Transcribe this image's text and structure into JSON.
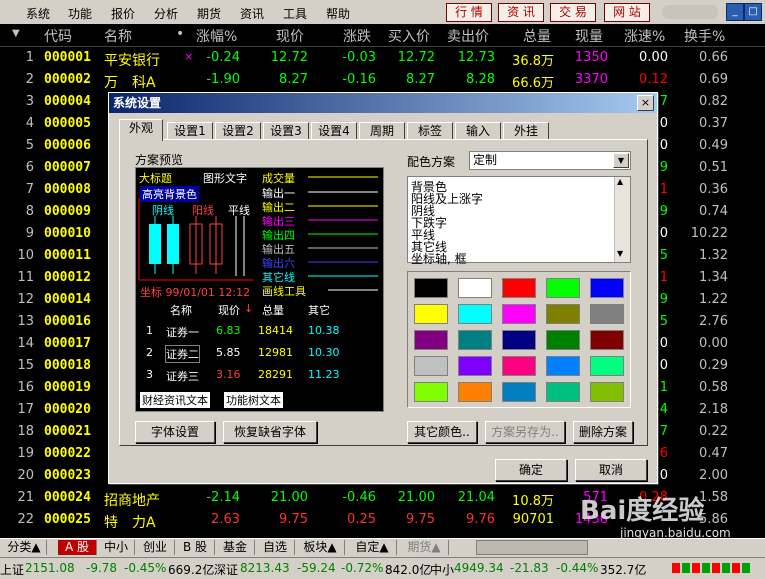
{
  "menu": [
    "系统",
    "功能",
    "报价",
    "分析",
    "期货",
    "资讯",
    "工具",
    "帮助"
  ],
  "toolbar_buttons": [
    "行 情",
    "资 讯",
    "交 易",
    "网 站"
  ],
  "window_controls": [
    "_",
    "□",
    "×"
  ],
  "columns": [
    "代码",
    "名称",
    "•",
    "涨幅%",
    "现价",
    "涨跌",
    "买入价",
    "卖出价",
    "总量",
    "现量",
    "涨速%",
    "换手%"
  ],
  "rows": [
    {
      "n": "1",
      "code": "000001",
      "name": "平安银行",
      "mark": "×",
      "chg_pct": "-0.24",
      "price": "12.72",
      "chg": "-0.03",
      "bid": "12.72",
      "ask": "12.73",
      "vol": "36.8万",
      "cur": "1350",
      "speed": "0.00",
      "turn": "0.66"
    },
    {
      "n": "2",
      "code": "000002",
      "name": "万　科A",
      "mark": "",
      "chg_pct": "-1.90",
      "price": "8.27",
      "chg": "-0.16",
      "bid": "8.27",
      "ask": "8.28",
      "vol": "66.6万",
      "cur": "3370",
      "speed": "0.12",
      "turn": "0.69"
    },
    {
      "n": "3",
      "code": "000004",
      "name": "",
      "speed": "7",
      "turn": "0.82"
    },
    {
      "n": "4",
      "code": "000005",
      "name": "",
      "speed": "0",
      "turn": "0.37"
    },
    {
      "n": "5",
      "code": "000006",
      "name": "",
      "speed": "0",
      "turn": "0.49"
    },
    {
      "n": "6",
      "code": "000007",
      "name": "",
      "speed": "9",
      "turn": "0.51"
    },
    {
      "n": "7",
      "code": "000008",
      "name": "",
      "speed": "1",
      "turn": "0.36"
    },
    {
      "n": "8",
      "code": "000009",
      "name": "",
      "speed": "9",
      "turn": "0.74"
    },
    {
      "n": "9",
      "code": "000010",
      "name": "",
      "speed": "0",
      "turn": "10.22"
    },
    {
      "n": "10",
      "code": "000011",
      "name": "",
      "speed": "5",
      "turn": "1.32"
    },
    {
      "n": "11",
      "code": "000012",
      "name": "",
      "speed": "1",
      "turn": "1.34"
    },
    {
      "n": "12",
      "code": "000014",
      "name": "",
      "speed": "9",
      "turn": "1.22"
    },
    {
      "n": "13",
      "code": "000016",
      "name": "",
      "speed": "5",
      "turn": "2.76"
    },
    {
      "n": "14",
      "code": "000017",
      "name": "",
      "speed": "0",
      "turn": "0.00"
    },
    {
      "n": "15",
      "code": "000018",
      "name": "",
      "speed": "0",
      "turn": "0.29"
    },
    {
      "n": "16",
      "code": "000019",
      "name": "",
      "speed": "1",
      "turn": "0.58"
    },
    {
      "n": "17",
      "code": "000020",
      "name": "",
      "speed": "4",
      "turn": "2.18"
    },
    {
      "n": "18",
      "code": "000021",
      "name": "",
      "speed": "7",
      "turn": "0.22"
    },
    {
      "n": "19",
      "code": "000022",
      "name": "",
      "speed": "6",
      "turn": "0.47"
    },
    {
      "n": "20",
      "code": "000023",
      "name": "",
      "speed": "0",
      "turn": "2.00"
    },
    {
      "n": "21",
      "code": "000024",
      "name": "招商地产",
      "mark": "",
      "chg_pct": "-2.14",
      "price": "21.00",
      "chg": "-0.46",
      "bid": "21.00",
      "ask": "21.04",
      "vol": "10.8万",
      "cur": "571",
      "speed": "0.28",
      "turn": "1.58"
    },
    {
      "n": "22",
      "code": "000025",
      "name": "特　力A",
      "mark": "",
      "chg_pct": "2.63",
      "price": "9.75",
      "chg": "0.25",
      "bid": "9.75",
      "ask": "9.76",
      "vol": "90701",
      "cur": "1436",
      "speed": "",
      "turn": "5.86"
    }
  ],
  "dialog": {
    "title": "系统设置",
    "close": "×",
    "tabs": [
      "外观",
      "设置1",
      "设置2",
      "设置3",
      "设置4",
      "周期",
      "标签",
      "输入",
      "外挂"
    ],
    "preview_label": "方案预览",
    "preview": {
      "big_title": "大标题",
      "graph_text": "图形文字",
      "hl_bg": "高亮背景色",
      "yin": "阴线",
      "yang": "阳线",
      "ping": "平线",
      "coord": "坐标 99/01/01 12:12",
      "outputs": [
        "成交量",
        "输出一",
        "输出二",
        "输出三",
        "输出四",
        "输出五",
        "输出六",
        "其它线",
        "画线工具"
      ],
      "table_head": [
        "名称",
        "现价",
        "总量",
        "其它"
      ],
      "table_rows": [
        {
          "i": "1",
          "name": "证券一",
          "price": "6.83",
          "vol": "18414",
          "other": "10.38"
        },
        {
          "i": "2",
          "name": "证券二",
          "price": "5.85",
          "vol": "12981",
          "other": "10.30"
        },
        {
          "i": "3",
          "name": "证券三",
          "price": "3.16",
          "vol": "28291",
          "other": "11.23"
        }
      ],
      "btn_fin": "财经资讯文本",
      "btn_func": "功能树文本"
    },
    "scheme_label": "配色方案",
    "scheme_value": "定制",
    "color_items": [
      "背景色",
      "阳线及上涨字",
      "阴线",
      "下跌字",
      "平线",
      "其它线",
      "坐标轴, 框"
    ],
    "swatches": [
      "#000000",
      "#ffffff",
      "#ff0000",
      "#00ff00",
      "#0000ff",
      "#ffff00",
      "#00ffff",
      "#ff00ff",
      "#808000",
      "#808080",
      "#800080",
      "#008080",
      "#000080",
      "#008000",
      "#800000",
      "#c0c0c0",
      "#8000ff",
      "#ff0080",
      "#0080ff",
      "#00ff80",
      "#80ff00",
      "#ff8000",
      "#0080c0",
      "#00c080",
      "#80c000"
    ],
    "btn_font": "字体设置",
    "btn_restore": "恢复缺省字体",
    "btn_other_color": "其它颜色..",
    "btn_save_as": "方案另存为..",
    "btn_delete": "删除方案",
    "btn_ok": "确定",
    "btn_cancel": "取消"
  },
  "bottom_tabs": [
    "分类▲",
    "A 股",
    "中小",
    "创业",
    "B 股",
    "基金",
    "自选",
    "板块▲",
    "自定▲",
    "期货▲"
  ],
  "status": {
    "sh_label": "上证",
    "sh_index": "2151.08",
    "sh_chg": "-9.78",
    "sh_pct": "-0.45%",
    "sh_amt": "669.2亿",
    "sz_label": "深证",
    "sz_index": "8213.43",
    "sz_chg": "-59.24",
    "sz_pct": "-0.72%",
    "sz_amt": "842.0亿",
    "zx_label": "中小",
    "zx_index": "4949.34",
    "zx_chg": "-21.83",
    "zx_pct": "-0.44%",
    "zx_amt": "352.7亿"
  },
  "watermark": "Bai度经验",
  "watermark_url": "jingyan.baidu.com"
}
